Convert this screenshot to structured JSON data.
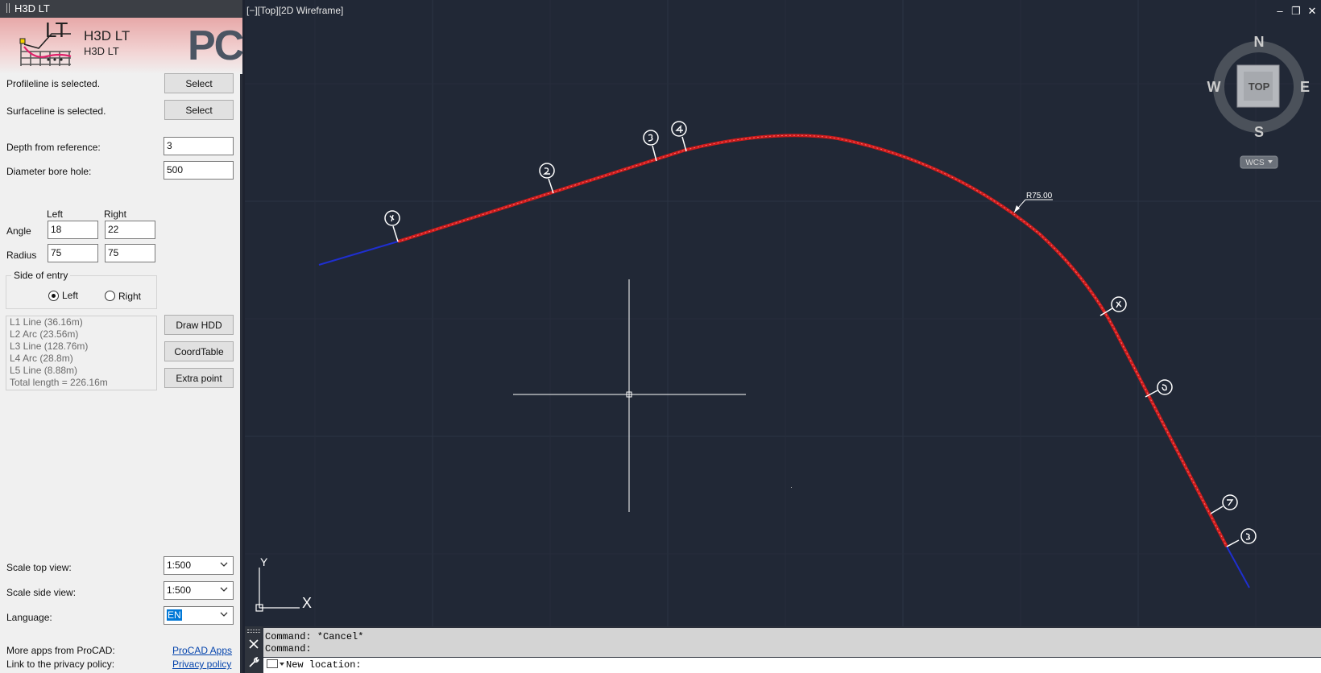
{
  "palette": {
    "title": "H3D LT",
    "logo_text": "LT",
    "banner_title": "H3D LT",
    "banner_subtitle": "H3D LT",
    "brand_mark": "PC",
    "profileline_status": "Profileline is selected.",
    "profileline_button": "Select",
    "surfaceline_status": "Surfaceline is selected.",
    "surfaceline_button": "Select",
    "depth_label": "Depth from reference:",
    "depth_value": "3",
    "diameter_label": "Diameter bore hole:",
    "diameter_value": "500",
    "col_left": "Left",
    "col_right": "Right",
    "angle_label": "Angle",
    "angle_left": "18",
    "angle_right": "22",
    "radius_label": "Radius",
    "radius_left": "75",
    "radius_right": "75",
    "side_entry_label": "Side of entry",
    "side_left": "Left",
    "side_right": "Right",
    "side_selected": "Left",
    "summary": [
      "L1 Line (36.16m)",
      "L2 Arc (23.56m)",
      "L3 Line (128.76m)",
      "L4 Arc (28.8m)",
      "L5 Line (8.88m)",
      "Total length = 226.16m"
    ],
    "draw_button": "Draw HDD",
    "coord_button": "CoordTable",
    "extra_button": "Extra point",
    "scale_top_label": "Scale top view:",
    "scale_top_value": "1:500",
    "scale_side_label": "Scale side view:",
    "scale_side_value": "1:500",
    "language_label": "Language:",
    "language_value": "EN",
    "more_apps_label": "More apps from ProCAD:",
    "more_apps_link": "ProCAD Apps",
    "privacy_label": "Link to the privacy policy:",
    "privacy_link": "Privacy policy"
  },
  "viewport": {
    "label": "[−][Top][2D Wireframe]",
    "window_controls": [
      "–",
      "❐",
      "✕"
    ],
    "viewcube": {
      "face": "TOP",
      "north": "N",
      "south": "S",
      "east": "E",
      "west": "W",
      "ucs_menu": "WCS"
    },
    "dimension_label": "R75.00",
    "ucs_x": "X",
    "ucs_y": "Y",
    "colors": {
      "background": "#212836",
      "grid": "#2c3444",
      "path": "#cc1c1c",
      "extension": "#1f2fd0"
    }
  },
  "command_line": {
    "history": [
      "Command: *Cancel*",
      "Command:"
    ],
    "prompt": "New location:"
  }
}
